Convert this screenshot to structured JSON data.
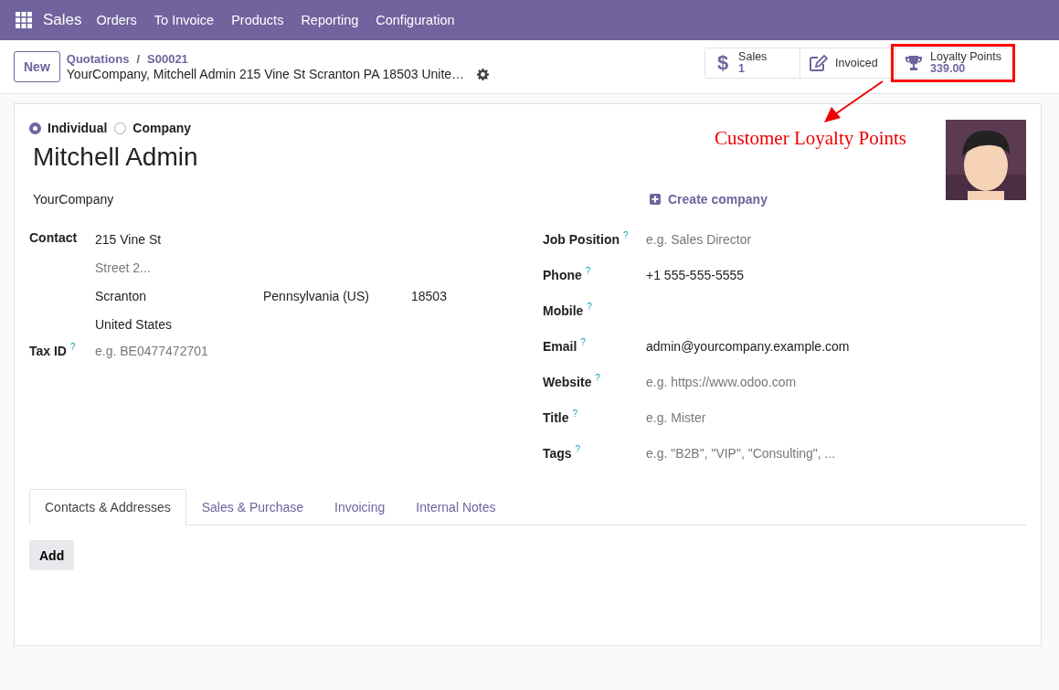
{
  "navbar": {
    "app": "Sales",
    "menu": [
      "Orders",
      "To Invoice",
      "Products",
      "Reporting",
      "Configuration"
    ]
  },
  "control_panel": {
    "new_button": "New",
    "breadcrumb": {
      "parent": "Quotations",
      "separator": "/",
      "current": "S00021"
    },
    "record_title": "YourCompany, Mitchell Admin 215 Vine St Scranton PA 18503 Unite…",
    "smart_buttons": [
      {
        "kind": "sales",
        "icon": "$",
        "label": "Sales",
        "value": "1",
        "highlighted": false
      },
      {
        "kind": "invoiced",
        "label": "Invoiced",
        "highlighted": false
      },
      {
        "kind": "loyalty",
        "label": "Loyalty Points",
        "value": "339.00",
        "highlighted": true
      }
    ]
  },
  "annotation": {
    "text": "Customer Loyalty Points"
  },
  "form": {
    "company_type": [
      {
        "label": "Individual",
        "selected": true
      },
      {
        "label": "Company",
        "selected": false
      }
    ],
    "name": "Mitchell Admin",
    "company": "YourCompany",
    "create_company": "Create company",
    "address": {
      "label": "Contact",
      "street": "215 Vine St",
      "street2_placeholder": "Street 2...",
      "city": "Scranton",
      "state": "Pennsylvania (US)",
      "zip": "18503",
      "country": "United States"
    },
    "tax_id": {
      "label": "Tax ID",
      "help": "?",
      "placeholder": "e.g. BE0477472701"
    },
    "right_fields": [
      {
        "label": "Job Position",
        "help": "?",
        "placeholder": "e.g. Sales Director"
      },
      {
        "label": "Phone",
        "help": "?",
        "value": "+1 555-555-5555"
      },
      {
        "label": "Mobile",
        "help": "?"
      },
      {
        "label": "Email",
        "help": "?",
        "value": "admin@yourcompany.example.com"
      },
      {
        "label": "Website",
        "help": "?",
        "placeholder": "e.g. https://www.odoo.com"
      },
      {
        "label": "Title",
        "help": "?",
        "placeholder": "e.g. Mister"
      },
      {
        "label": "Tags",
        "help": "?",
        "placeholder": "e.g. \"B2B\", \"VIP\", \"Consulting\", ..."
      }
    ],
    "tabs": [
      {
        "label": "Contacts & Addresses",
        "selected": true
      },
      {
        "label": "Sales & Purchase",
        "selected": false
      },
      {
        "label": "Invoicing",
        "selected": false
      },
      {
        "label": "Internal Notes",
        "selected": false
      }
    ],
    "add_button": "Add"
  }
}
